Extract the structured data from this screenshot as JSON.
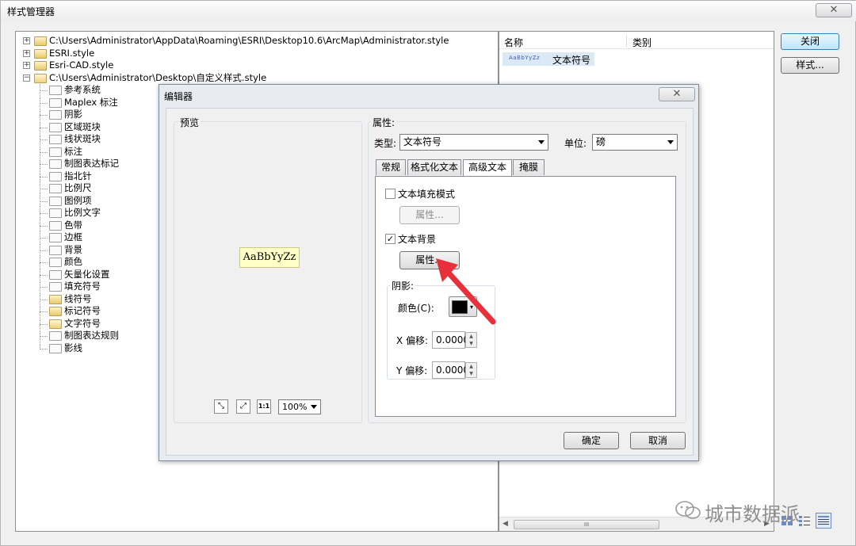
{
  "window": {
    "title": "样式管理器",
    "close_glyph": "✕"
  },
  "tree": {
    "roots": [
      {
        "label": "C:\\Users\\Administrator\\AppData\\Roaming\\ESRI\\Desktop10.6\\ArcMap\\Administrator.style",
        "expander": "+"
      },
      {
        "label": "ESRI.style",
        "expander": "+"
      },
      {
        "label": "Esri-CAD.style",
        "expander": "+"
      },
      {
        "label": "C:\\Users\\Administrator\\Desktop\\自定义样式.style",
        "expander": "−"
      }
    ],
    "children": [
      "参考系统",
      "Maplex 标注",
      "阴影",
      "区域斑块",
      "线状斑块",
      "标注",
      "制图表达标记",
      "指北针",
      "比例尺",
      "图例项",
      "比例文字",
      "色带",
      "边框",
      "背景",
      "颜色",
      "矢量化设置",
      "填充符号",
      "线符号",
      "标记符号",
      "文字符号",
      "制图表达规则",
      "影线"
    ]
  },
  "list": {
    "columns": [
      "名称",
      "类别"
    ],
    "item": {
      "preview": "AaBbYyZz",
      "name": "文本符号"
    },
    "scroll_thumb_glyph": "III"
  },
  "buttons": {
    "close": "关闭",
    "styles": "样式..."
  },
  "editor": {
    "title": "编辑器",
    "close_glyph": "✕",
    "preview_label": "预览",
    "preview_sample": "AaBbYyZz",
    "zoom_buttons": [
      "fit-icon",
      "expand-icon",
      "actual-size-icon"
    ],
    "zoom_actual_glyph": "1:1",
    "zoom_value": "100%",
    "properties_label": "属性:",
    "type_label": "类型:",
    "type_value": "文本符号",
    "unit_label": "单位:",
    "unit_value": "磅",
    "tabs": [
      "常规",
      "格式化文本",
      "高级文本",
      "掩膜"
    ],
    "active_tab": 2,
    "text_fill_pattern": {
      "label": "文本填充模式",
      "checked": false,
      "button": "属性..."
    },
    "text_background": {
      "label": "文本背景",
      "checked": true,
      "button": "属性..."
    },
    "shadow": {
      "label": "阴影:",
      "color_label": "颜色(C):",
      "color": "#000000",
      "x_label": "X 偏移:",
      "x_value": "0.0000",
      "y_label": "Y 偏移:",
      "y_value": "0.0000"
    },
    "ok": "确定",
    "cancel": "取消"
  },
  "watermark": {
    "text": "城市数据派"
  },
  "colors": {
    "arrow": "#e8303a",
    "accent": "#3c7fb1"
  }
}
